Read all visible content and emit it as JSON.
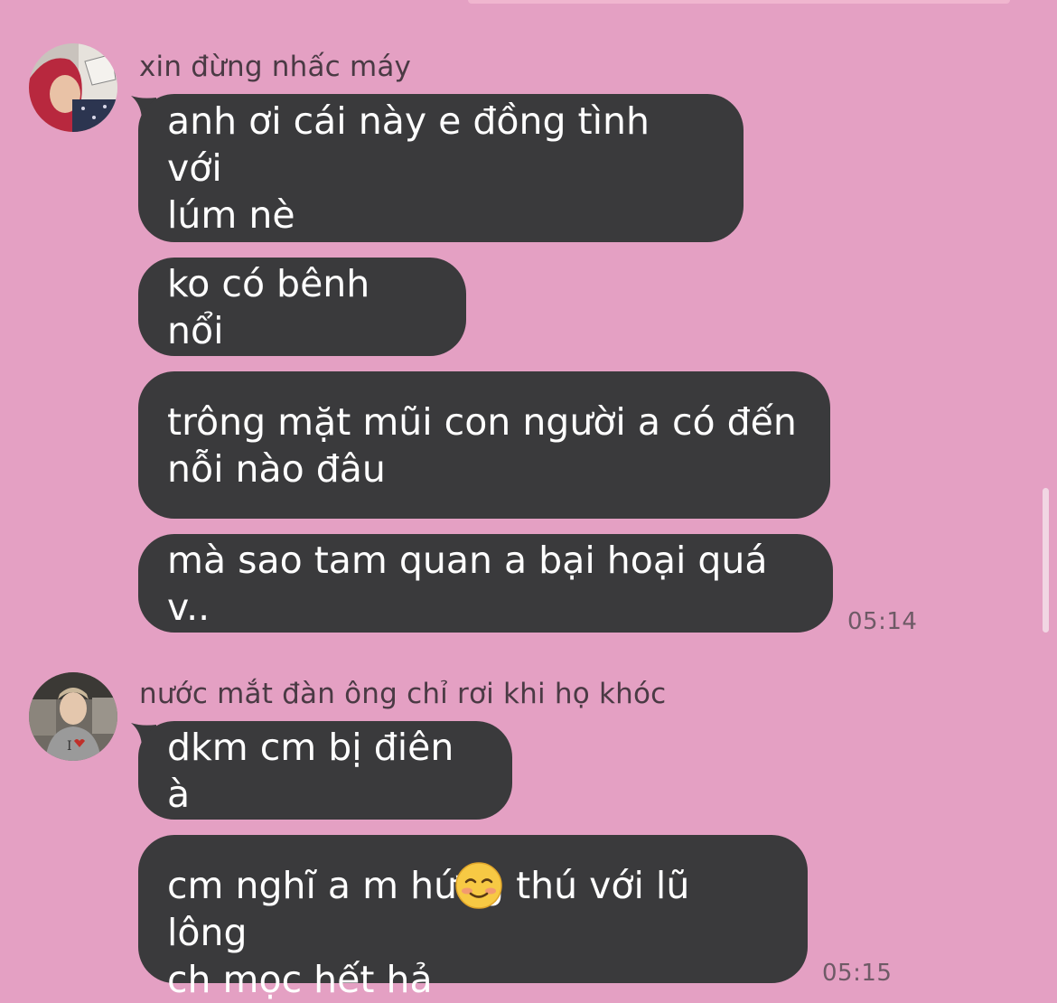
{
  "conversation": {
    "groups": [
      {
        "sender_name": "xin đừng nhấc máy",
        "messages": [
          "anh ơi cái này e đồng tình với\nlúm nè",
          "ko có bênh nổi",
          "trông mặt mũi con người a có đến\nnỗi nào đâu",
          "mà sao tam quan a bại hoại quá v.."
        ],
        "time": "05:14"
      },
      {
        "sender_name": "nước mắt đàn ông chỉ rơi khi họ khóc",
        "messages": [
          "dkm cm bị điên à",
          "cm nghĩ a m hứng thú với lũ lông\nch mọc hết hả"
        ],
        "emoji": "smiling-face-with-blush-icon",
        "time": "05:15"
      }
    ]
  },
  "colors": {
    "background": "#e4a0c3",
    "bubble": "#3a3a3c",
    "bubble_text": "#ffffff",
    "sender_text": "#4a3a44",
    "time_text": "#6e5a66"
  }
}
